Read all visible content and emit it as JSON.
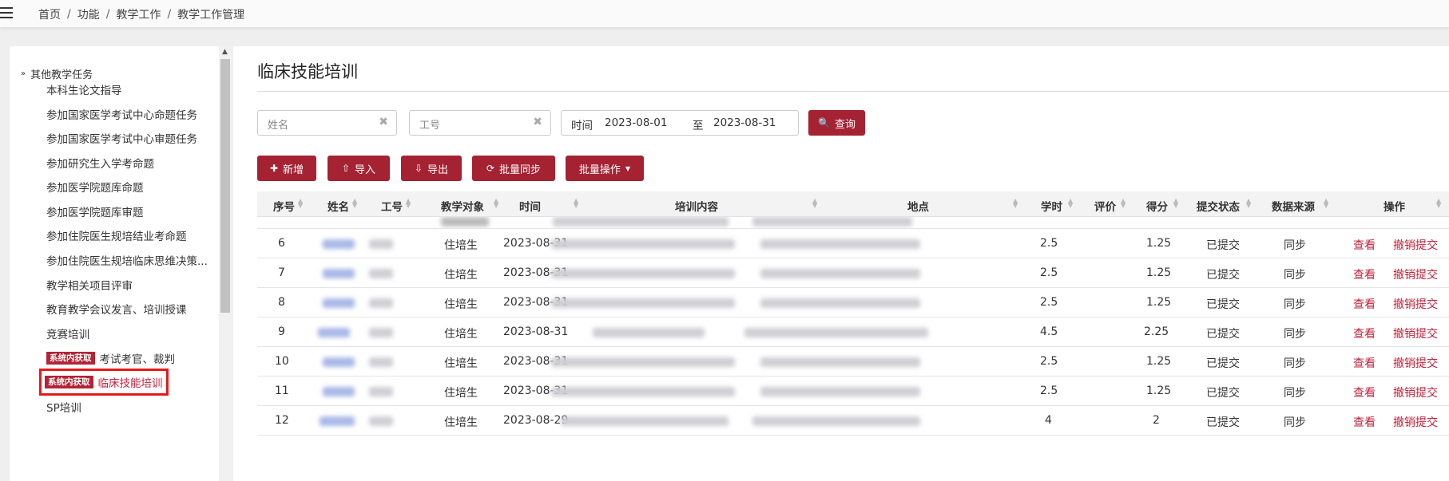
{
  "breadcrumb": [
    "首页",
    "功能",
    "教学工作",
    "教学工作管理"
  ],
  "sidebar": {
    "group": "其他教学任务",
    "items": [
      {
        "label": "本科生论文指导"
      },
      {
        "label": "参加国家医学考试中心命题任务"
      },
      {
        "label": "参加国家医学考试中心审题任务"
      },
      {
        "label": "参加研究生入学考命题"
      },
      {
        "label": "参加医学院题库命题"
      },
      {
        "label": "参加医学院题库审题"
      },
      {
        "label": "参加住院医生规培结业考命题"
      },
      {
        "label": "参加住院医生规培临床思维决策..."
      },
      {
        "label": "教学相关项目评审"
      },
      {
        "label": "教育教学会议发言、培训授课"
      },
      {
        "label": "竞赛培训"
      },
      {
        "label": "考试考官、裁判",
        "tag": "系统内获取"
      },
      {
        "label": "临床技能培训",
        "tag": "系统内获取"
      },
      {
        "label": "SP培训"
      }
    ]
  },
  "page": {
    "title": "临床技能培训"
  },
  "filters": {
    "name_placeholder": "姓名",
    "id_placeholder": "工号",
    "time_label": "时间",
    "date_from": "2023-08-01",
    "date_sep": "至",
    "date_to": "2023-08-31",
    "query": "查询"
  },
  "toolbar": {
    "add": "新增",
    "import": "导入",
    "export": "导出",
    "sync": "批量同步",
    "batch": "批量操作"
  },
  "table": {
    "headers": [
      "序号",
      "姓名",
      "工号",
      "教学对象",
      "时间",
      "培训内容",
      "地点",
      "学时",
      "评价",
      "得分",
      "提交状态",
      "数据来源",
      "操作"
    ],
    "view_label": "查看",
    "revoke_label": "撤销提交",
    "rows": [
      {
        "no": "6",
        "target": "住培生",
        "date": "2023-08-31",
        "hours": "2.5",
        "score": "1.25",
        "status": "已提交",
        "source": "同步"
      },
      {
        "no": "7",
        "target": "住培生",
        "date": "2023-08-31",
        "hours": "2.5",
        "score": "1.25",
        "status": "已提交",
        "source": "同步"
      },
      {
        "no": "8",
        "target": "住培生",
        "date": "2023-08-31",
        "hours": "2.5",
        "score": "1.25",
        "status": "已提交",
        "source": "同步"
      },
      {
        "no": "9",
        "target": "住培生",
        "date": "2023-08-31",
        "hours": "4.5",
        "score": "2.25",
        "status": "已提交",
        "source": "同步"
      },
      {
        "no": "10",
        "target": "住培生",
        "date": "2023-08-31",
        "hours": "2.5",
        "score": "1.25",
        "status": "已提交",
        "source": "同步"
      },
      {
        "no": "11",
        "target": "住培生",
        "date": "2023-08-31",
        "hours": "2.5",
        "score": "1.25",
        "status": "已提交",
        "source": "同步"
      },
      {
        "no": "12",
        "target": "住培生",
        "date": "2023-08-29",
        "hours": "4",
        "score": "2",
        "status": "已提交",
        "source": "同步"
      }
    ]
  }
}
